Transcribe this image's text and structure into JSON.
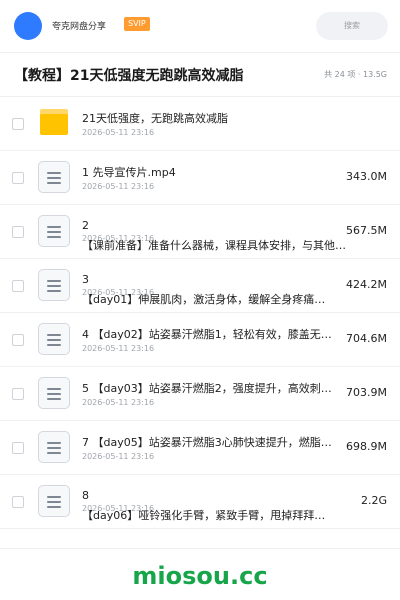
{
  "header": {
    "app_name": "夸克网盘分享",
    "badge": "SVIP",
    "search_label": "搜索"
  },
  "share": {
    "title": "【教程】21天低强度无跑跳高效减脂",
    "meta": "共 24 项 · 13.5G"
  },
  "files": [
    {
      "type": "folder",
      "name": "21天低强度，无跑跳高效减脂",
      "date": "2026-05-11 23:16",
      "size": ""
    },
    {
      "type": "file",
      "name": "1 先导宣传片.mp4",
      "date": "2026-05-11 23:16",
      "size": "343.0M"
    },
    {
      "type": "file",
      "num": "2",
      "desc": "【课前准备】准备什么器械，课程具体安排，与其他…",
      "date": "2026-05-11 23:16",
      "size": "567.5M"
    },
    {
      "type": "file",
      "num": "3",
      "desc": "【day01】伸展肌肉，激活身体，缓解全身疼痛…",
      "date": "2026-05-11 23:16",
      "size": "424.2M"
    },
    {
      "type": "file",
      "name": "4 【day02】站姿暴汗燃脂1，轻松有效，膝盖无…",
      "date": "2026-05-11 23:16",
      "size": "704.6M"
    },
    {
      "type": "file",
      "name": "5 【day03】站姿暴汗燃脂2，强度提升，高效刺…",
      "date": "2026-05-11 23:16",
      "size": "703.9M"
    },
    {
      "type": "file",
      "name": "7 【day05】站姿暴汗燃脂3心肺快速提升，燃脂…",
      "date": "2026-05-11 23:16",
      "size": "698.9M"
    },
    {
      "type": "file",
      "num": "8",
      "desc": "【day06】哑铃强化手臂，紧致手臂，甩掉拜拜…",
      "date": "2026-05-11 23:16",
      "size": "2.2G"
    }
  ],
  "watermark": "miosou.cc",
  "colors": {
    "accent": "#2f7bff",
    "badge": "#ff9b2f",
    "folder": "#ffc300",
    "watermark": "#17a54a"
  },
  "icons": {
    "folder": "folder-icon",
    "file": "document-icon",
    "avatar": "avatar"
  }
}
